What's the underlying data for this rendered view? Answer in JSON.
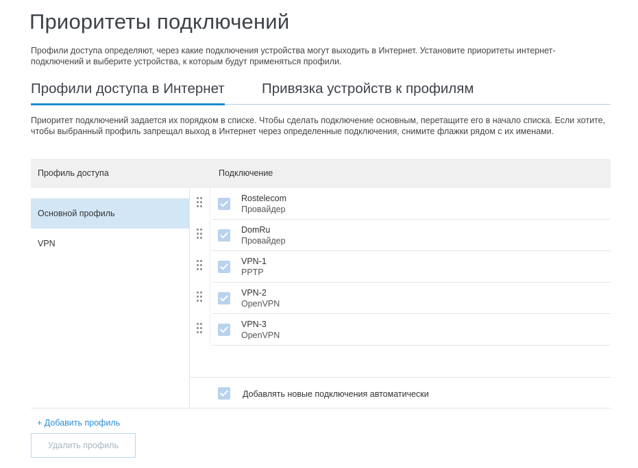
{
  "page": {
    "title": "Приоритеты подключений",
    "intro": "Профили доступа определяют, через какие подключения устройства могут выходить в Интернет. Установите приоритеты интернет-подключений и выберите устройства, к которым будут применяться профили."
  },
  "tabs": [
    {
      "label": "Профили доступа в Интернет",
      "active": true
    },
    {
      "label": "Привязка устройств к профилям",
      "active": false
    }
  ],
  "description": "Приоритет подключений задается их порядком в списке. Чтобы сделать подключение основным, перетащите его в начало списка. Если хотите, чтобы выбранный профиль запрещал выход в Интернет через определенные подключения, снимите флажки рядом с их именами.",
  "table": {
    "headers": {
      "profile": "Профиль доступа",
      "connection": "Подключение"
    },
    "profiles": [
      {
        "label": "Основной профиль",
        "selected": true
      },
      {
        "label": "VPN",
        "selected": false
      }
    ],
    "add_profile_label": "+ Добавить профиль",
    "connections": [
      {
        "name": "Rostelecom",
        "type": "Провайдер",
        "checked": true
      },
      {
        "name": "DomRu",
        "type": "Провайдер",
        "checked": true
      },
      {
        "name": "VPN-1",
        "type": "PPTP",
        "checked": true
      },
      {
        "name": "VPN-2",
        "type": "OpenVPN",
        "checked": true
      },
      {
        "name": "VPN-3",
        "type": "OpenVPN",
        "checked": true
      }
    ],
    "auto_add": {
      "label": "Добавлять новые подключения автоматически",
      "checked": true
    }
  },
  "delete_button_label": "Удалить профиль",
  "colors": {
    "accent": "#1f8bd0",
    "selected_row": "#d3e6f6",
    "checkbox": "#b9d3ee",
    "link": "#2c8ed6"
  }
}
